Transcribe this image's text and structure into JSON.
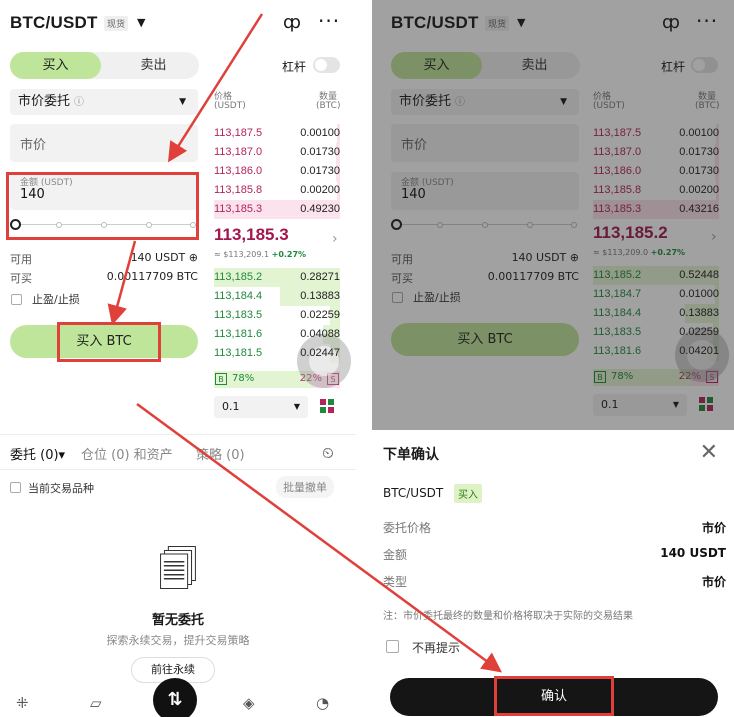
{
  "pair": "BTC/USDT",
  "spot_tag": "现货",
  "tabs": {
    "buy": "买入",
    "sell": "卖出"
  },
  "leverage": "杠杆",
  "order_type": "市价委托",
  "market_placeholder": "市价",
  "amount_label": "金额 (USDT)",
  "amount_value": "140",
  "avail_label": "可用",
  "avail_value": "140 USDT ⊕",
  "buyable_label": "可买",
  "buyable_value": "0.00117709 BTC",
  "tpsl": "止盈/止损",
  "buy_button": "买入 BTC",
  "ob_head": {
    "price": "价格",
    "price_unit": "(USDT)",
    "qty": "数量",
    "qty_unit": "(BTC)"
  },
  "left_book": {
    "asks": [
      {
        "price": "113,187.5",
        "qty": "0.00100"
      },
      {
        "price": "113,187.0",
        "qty": "0.01730"
      },
      {
        "price": "113,186.0",
        "qty": "0.01730"
      },
      {
        "price": "113,185.8",
        "qty": "0.00200"
      },
      {
        "price": "113,185.3",
        "qty": "0.49230"
      }
    ],
    "last": "113,185.3",
    "ref": "≈ $113,209.1",
    "chg": "+0.27%",
    "bids": [
      {
        "price": "113,185.2",
        "qty": "0.28271"
      },
      {
        "price": "113,184.4",
        "qty": "0.13883"
      },
      {
        "price": "113,183.5",
        "qty": "0.02259"
      },
      {
        "price": "113,181.6",
        "qty": "0.04088"
      },
      {
        "price": "113,181.5",
        "qty": "0.02447"
      }
    ],
    "b_pct": "78%",
    "s_pct": "22%"
  },
  "right_book": {
    "asks": [
      {
        "price": "113,187.5",
        "qty": "0.00100"
      },
      {
        "price": "113,187.0",
        "qty": "0.01730"
      },
      {
        "price": "113,186.0",
        "qty": "0.01730"
      },
      {
        "price": "113,185.8",
        "qty": "0.00200"
      },
      {
        "price": "113,185.3",
        "qty": "0.43216"
      }
    ],
    "last": "113,185.2",
    "ref": "≈ $113,209.0",
    "chg": "+0.27%",
    "bids": [
      {
        "price": "113,185.2",
        "qty": "0.52448"
      },
      {
        "price": "113,184.7",
        "qty": "0.01000"
      },
      {
        "price": "113,184.4",
        "qty": "0.13883"
      },
      {
        "price": "113,183.5",
        "qty": "0.02259"
      },
      {
        "price": "113,181.6",
        "qty": "0.04201"
      }
    ],
    "b_pct": "78%",
    "s_pct": "22%"
  },
  "b": "B",
  "s": "S",
  "depth": "0.1",
  "bottom_tabs": {
    "orders": "委托 (0)▾",
    "positions": "仓位 (0) 和资产",
    "strategy": "策略 (0)"
  },
  "current_pair": "当前交易品种",
  "batch_cancel": "批量撤单",
  "empty_title": "暂无委托",
  "empty_sub": "探索永续交易，提升交易策略",
  "goto": "前往永续",
  "dialog": {
    "title": "下单确认",
    "pair": "BTC/USDT",
    "side": "买入",
    "rows": [
      {
        "k": "委托价格",
        "v": "市价"
      },
      {
        "k": "金额",
        "v": "140 USDT"
      },
      {
        "k": "类型",
        "v": "市价"
      }
    ],
    "note": "注：市价委托最终的数量和价格将取决于实际的交易结果",
    "no_remind": "不再提示",
    "confirm": "确认"
  },
  "colors": {
    "accent": "#bfe59a",
    "ask": "#b3245d",
    "bid": "#1f8a3c",
    "highlight": "#e0403a"
  }
}
